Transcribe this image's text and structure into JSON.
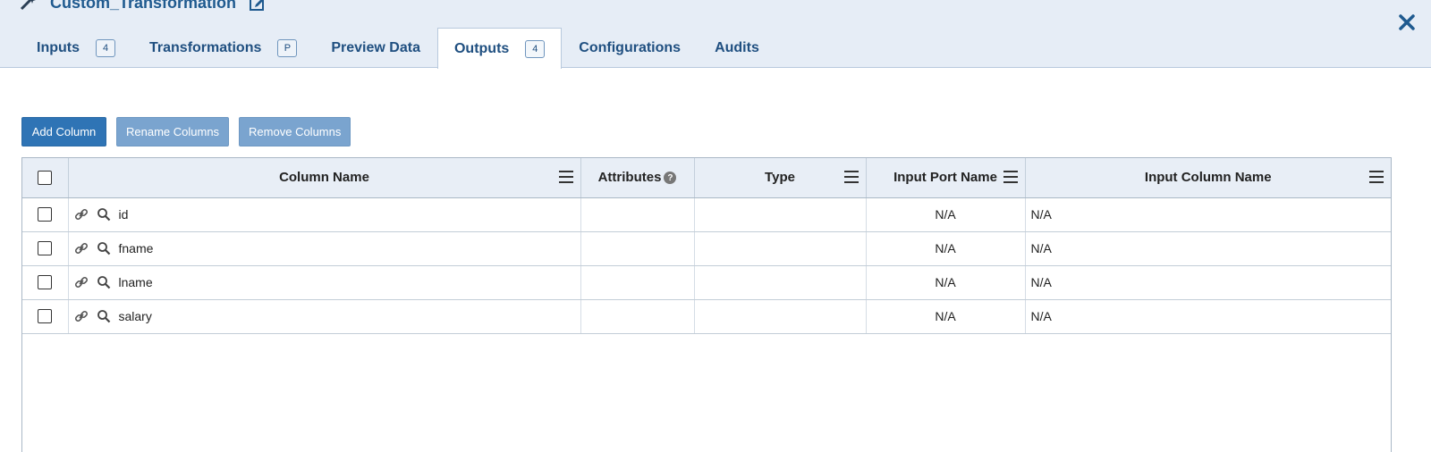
{
  "header": {
    "title": "Custom_Transformation",
    "tabs": [
      {
        "label": "Inputs",
        "badge": "4"
      },
      {
        "label": "Transformations",
        "badge": "P"
      },
      {
        "label": "Preview Data"
      },
      {
        "label": "Outputs",
        "badge": "4"
      },
      {
        "label": "Configurations"
      },
      {
        "label": "Audits"
      }
    ],
    "active_tab": "Outputs"
  },
  "toolbar": {
    "add_label": "Add Column",
    "rename_label": "Rename Columns",
    "remove_label": "Remove Columns"
  },
  "grid": {
    "columns": [
      "Column Name",
      "Attributes",
      "Type",
      "Input Port Name",
      "Input Column Name"
    ],
    "help_glyph": "?",
    "rows": [
      {
        "name": "id",
        "attributes": "",
        "type": "",
        "port": "N/A",
        "input_column": "N/A"
      },
      {
        "name": "fname",
        "attributes": "",
        "type": "",
        "port": "N/A",
        "input_column": "N/A"
      },
      {
        "name": "lname",
        "attributes": "",
        "type": "",
        "port": "N/A",
        "input_column": "N/A"
      },
      {
        "name": "salary",
        "attributes": "",
        "type": "",
        "port": "N/A",
        "input_column": "N/A"
      }
    ]
  },
  "colors": {
    "accent": "#2f74b5",
    "header_bg": "#e6edf6",
    "tab_text": "#1f4f80"
  },
  "icons": {
    "title": "magic-wand-icon",
    "edit": "edit-icon",
    "close": "close-icon",
    "row_link": "link-icon",
    "row_search": "search-icon",
    "column_menu": "menu-icon"
  }
}
